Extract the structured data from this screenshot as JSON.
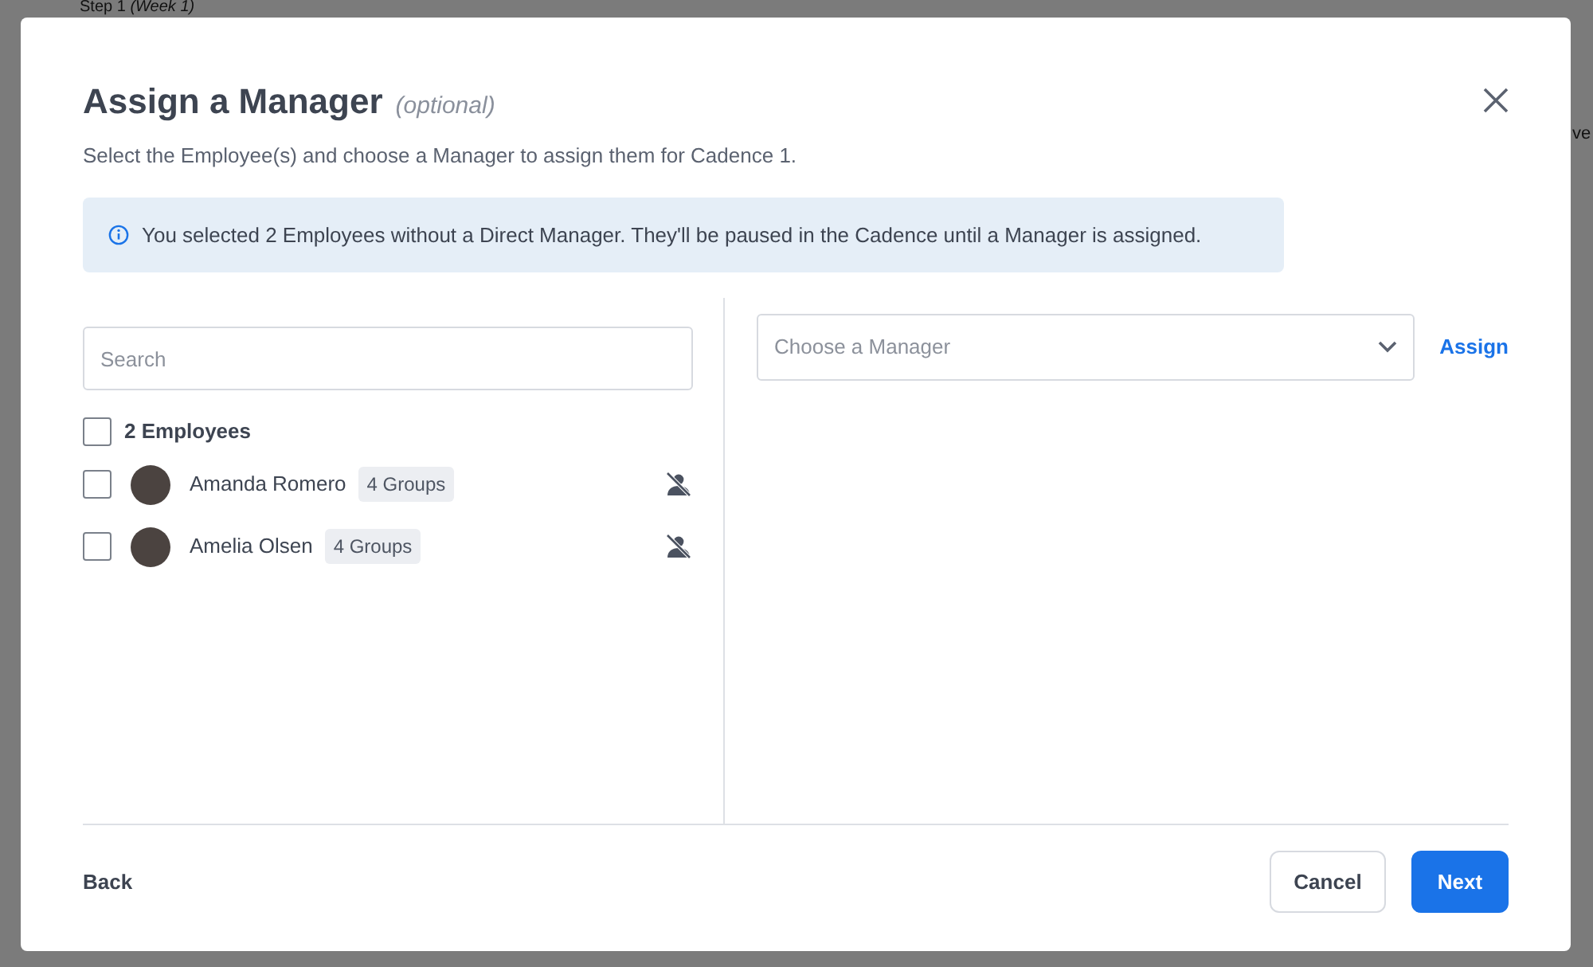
{
  "background": {
    "step_title": "Step 1",
    "step_week": "(Week 1)",
    "edge_text": "ve"
  },
  "modal": {
    "title": "Assign a Manager",
    "title_note": "(optional)",
    "subtitle": "Select the Employee(s) and choose a Manager to assign them for Cadence 1.",
    "alert": "You selected 2 Employees without a Direct Manager. They'll be paused in the Cadence until a Manager is assigned.",
    "search": {
      "placeholder": "Search"
    },
    "select_all": {
      "label": "2 Employees",
      "checked": false
    },
    "employees": [
      {
        "name": "Amanda Romero",
        "groups": "4 Groups",
        "checked": false
      },
      {
        "name": "Amelia Olsen",
        "groups": "4 Groups",
        "checked": false
      }
    ],
    "manager_select": {
      "placeholder": "Choose a Manager"
    },
    "assign_label": "Assign",
    "footer": {
      "back": "Back",
      "cancel": "Cancel",
      "next": "Next"
    }
  }
}
